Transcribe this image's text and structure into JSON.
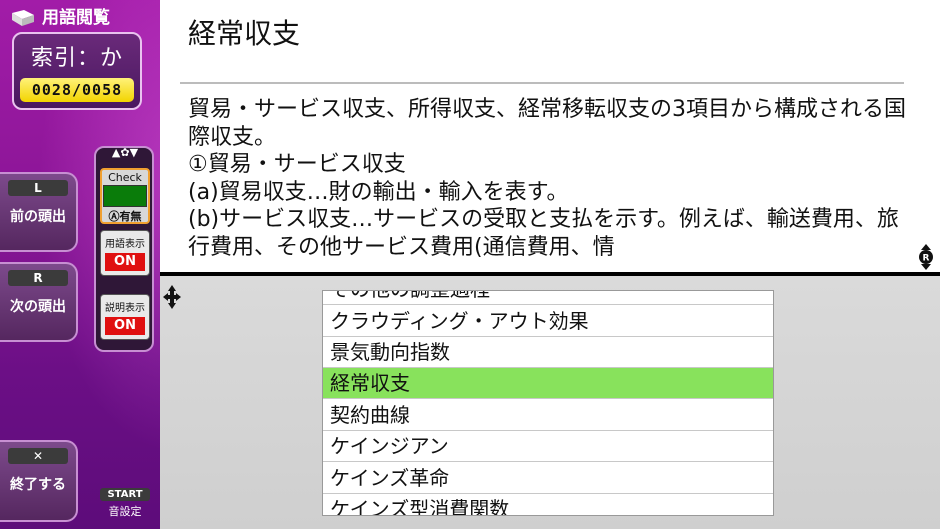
{
  "sidebar": {
    "title": "用語閲覧",
    "index_label": "索引：か",
    "counter": "0028/0058",
    "prev_key": "L",
    "prev_label": "前の頭出",
    "next_key": "R",
    "next_label": "次の頭出",
    "quit_key": "✕",
    "quit_label": "終了する",
    "check_label": "Check",
    "check_status": "Ⓐ有無",
    "term_toggle_label": "用語表示",
    "term_toggle_value": "ON",
    "desc_toggle_label": "説明表示",
    "desc_toggle_value": "ON",
    "start_key": "START",
    "start_label": "音設定"
  },
  "entry": {
    "title": "経常収支",
    "description": "貿易・サービス収支、所得収支、経常移転収支の3項目から構成される国際収支。\n①貿易・サービス収支\n(a)貿易収支…財の輸出・輸入を表す。\n(b)サービス収支…サービスの受取と支払を示す。例えば、輸送費用、旅行費用、その他サービス費用(通信費用、情"
  },
  "term_list": [
    {
      "label": "その他の調整過程",
      "selected": false
    },
    {
      "label": "クラウディング・アウト効果",
      "selected": false
    },
    {
      "label": "景気動向指数",
      "selected": false
    },
    {
      "label": "経常収支",
      "selected": true
    },
    {
      "label": "契約曲線",
      "selected": false
    },
    {
      "label": "ケインジアン",
      "selected": false
    },
    {
      "label": "ケインズ革命",
      "selected": false
    },
    {
      "label": "ケインズ型消費関数",
      "selected": false
    }
  ],
  "colors": {
    "sidebar_purple": "#8a1596",
    "selection_green": "#88e25c",
    "counter_yellow": "#f2d400",
    "toggle_red": "#e01010"
  }
}
